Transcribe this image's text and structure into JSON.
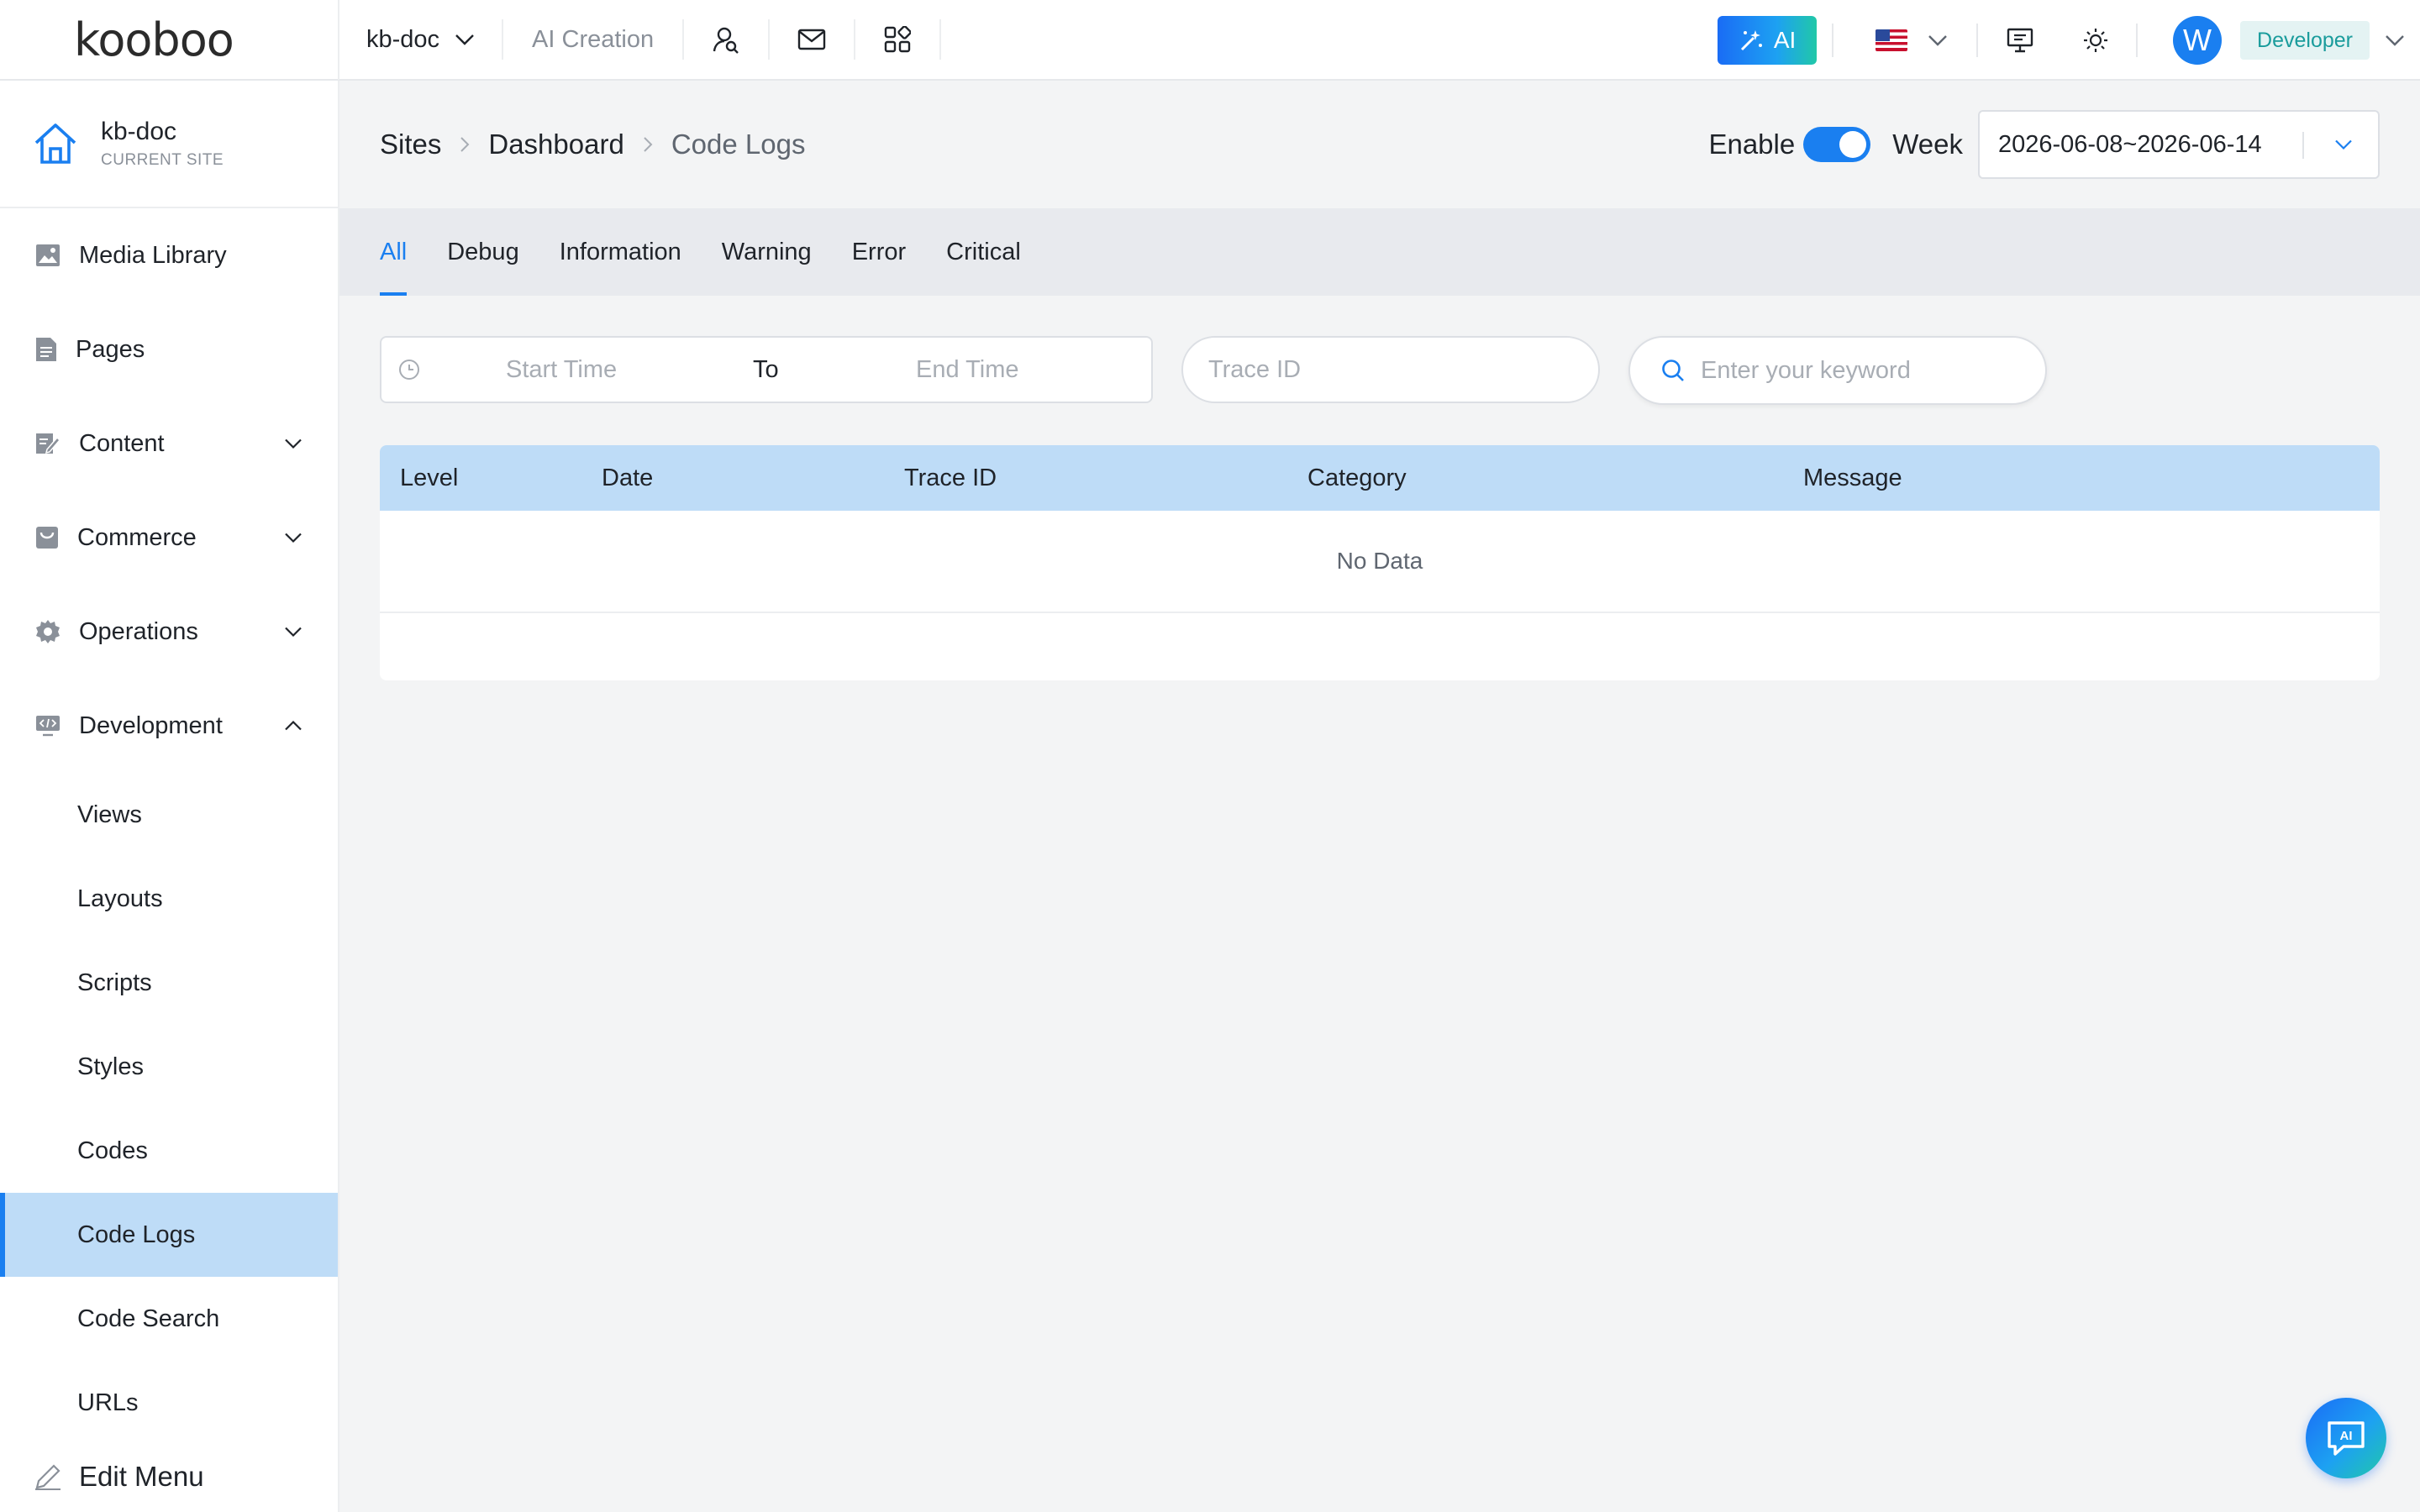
{
  "topbar": {
    "logo": "kooboo",
    "site": "kb-doc",
    "ai_creation": "AI Creation",
    "ai_button": "AI",
    "role": "Developer",
    "avatar_letter": "W",
    "icons": [
      "user-search-icon",
      "mail-icon",
      "apps-icon"
    ],
    "right_icons": [
      "flag-us-icon",
      "presentation-icon",
      "sun-icon"
    ]
  },
  "sidebar": {
    "current_site_name": "kb-doc",
    "current_site_sub": "CURRENT SITE",
    "items": [
      {
        "label": "Media Library",
        "icon": "image-icon"
      },
      {
        "label": "Pages",
        "icon": "document-icon"
      },
      {
        "label": "Content",
        "icon": "edit-doc-icon",
        "expandable": true
      },
      {
        "label": "Commerce",
        "icon": "store-icon",
        "expandable": true
      },
      {
        "label": "Operations",
        "icon": "gear-icon",
        "expandable": true
      },
      {
        "label": "Development",
        "icon": "code-icon",
        "expandable": true,
        "expanded": true
      }
    ],
    "sub_items": [
      "Views",
      "Layouts",
      "Scripts",
      "Styles",
      "Codes",
      "Code Logs",
      "Code Search",
      "URLs"
    ],
    "active_sub_item": "Code Logs",
    "edit_menu": "Edit Menu"
  },
  "header": {
    "breadcrumb": [
      "Sites",
      "Dashboard",
      "Code Logs"
    ],
    "enable_label": "Enable",
    "enable_on": true,
    "week_label": "Week",
    "week_value": "2026-06-08~2026-06-14"
  },
  "tabs": {
    "items": [
      "All",
      "Debug",
      "Information",
      "Warning",
      "Error",
      "Critical"
    ],
    "active": "All"
  },
  "filters": {
    "start_placeholder": "Start Time",
    "to_label": "To",
    "end_placeholder": "End Time",
    "trace_placeholder": "Trace ID",
    "keyword_placeholder": "Enter your keyword"
  },
  "table": {
    "columns": [
      "Level",
      "Date",
      "Trace ID",
      "Category",
      "Message"
    ],
    "empty_text": "No Data"
  },
  "colors": {
    "accent": "#1a7ff0",
    "header_blue": "#bedcf7",
    "role_text": "#1a9c9c"
  }
}
